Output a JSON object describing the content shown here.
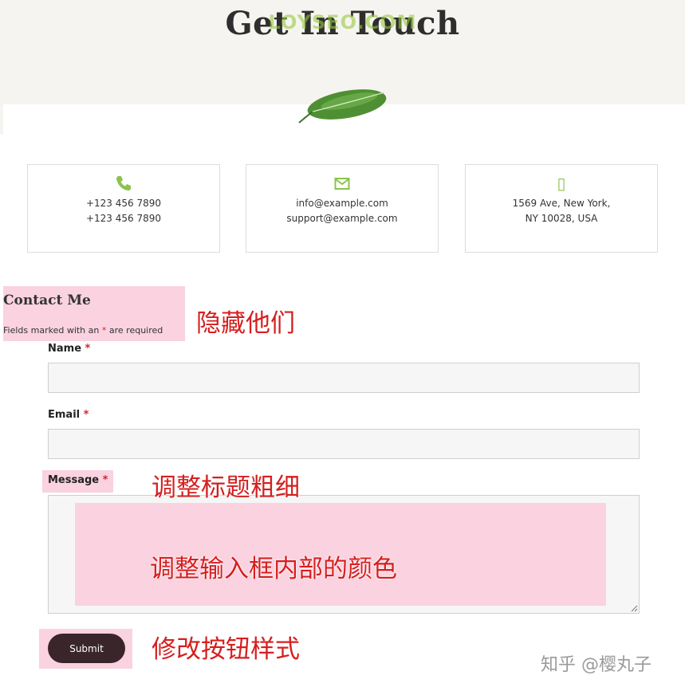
{
  "header": {
    "title": "Get In Touch",
    "watermark": "LOYSEO.COM"
  },
  "contact_info": [
    {
      "icon": "phone-icon",
      "line1": "+123 456 7890",
      "line2": "+123 456 7890"
    },
    {
      "icon": "envelope-icon",
      "line1": "info@example.com",
      "line2": "support@example.com"
    },
    {
      "icon": "missing-glyph-icon",
      "glyph": "▯",
      "line1": "1569 Ave, New York,",
      "line2": "NY 10028, USA"
    }
  ],
  "form": {
    "title": "Contact Me",
    "required_note_prefix": "Fields marked with an ",
    "required_note_mark": "*",
    "required_note_suffix": " are required",
    "fields": [
      {
        "label": "Name",
        "required_mark": "*",
        "value": ""
      },
      {
        "label": "Email",
        "required_mark": "*",
        "value": ""
      },
      {
        "label": "Message",
        "required_mark": "*",
        "value": ""
      }
    ],
    "submit_label": "Submit"
  },
  "annotations": {
    "hide_them": "隐藏他们",
    "adjust_title_weight": "调整标题粗细",
    "adjust_input_color": "调整输入框内部的颜色",
    "change_button_style": "修改按钮样式"
  },
  "credit": "知乎 @樱丸子",
  "colors": {
    "accent_green": "#8bc34a",
    "highlight_pink": "#fad2e0",
    "annotation_red": "#d51f1f",
    "button_dark": "#3a262a",
    "required_red": "#d02a2a"
  }
}
